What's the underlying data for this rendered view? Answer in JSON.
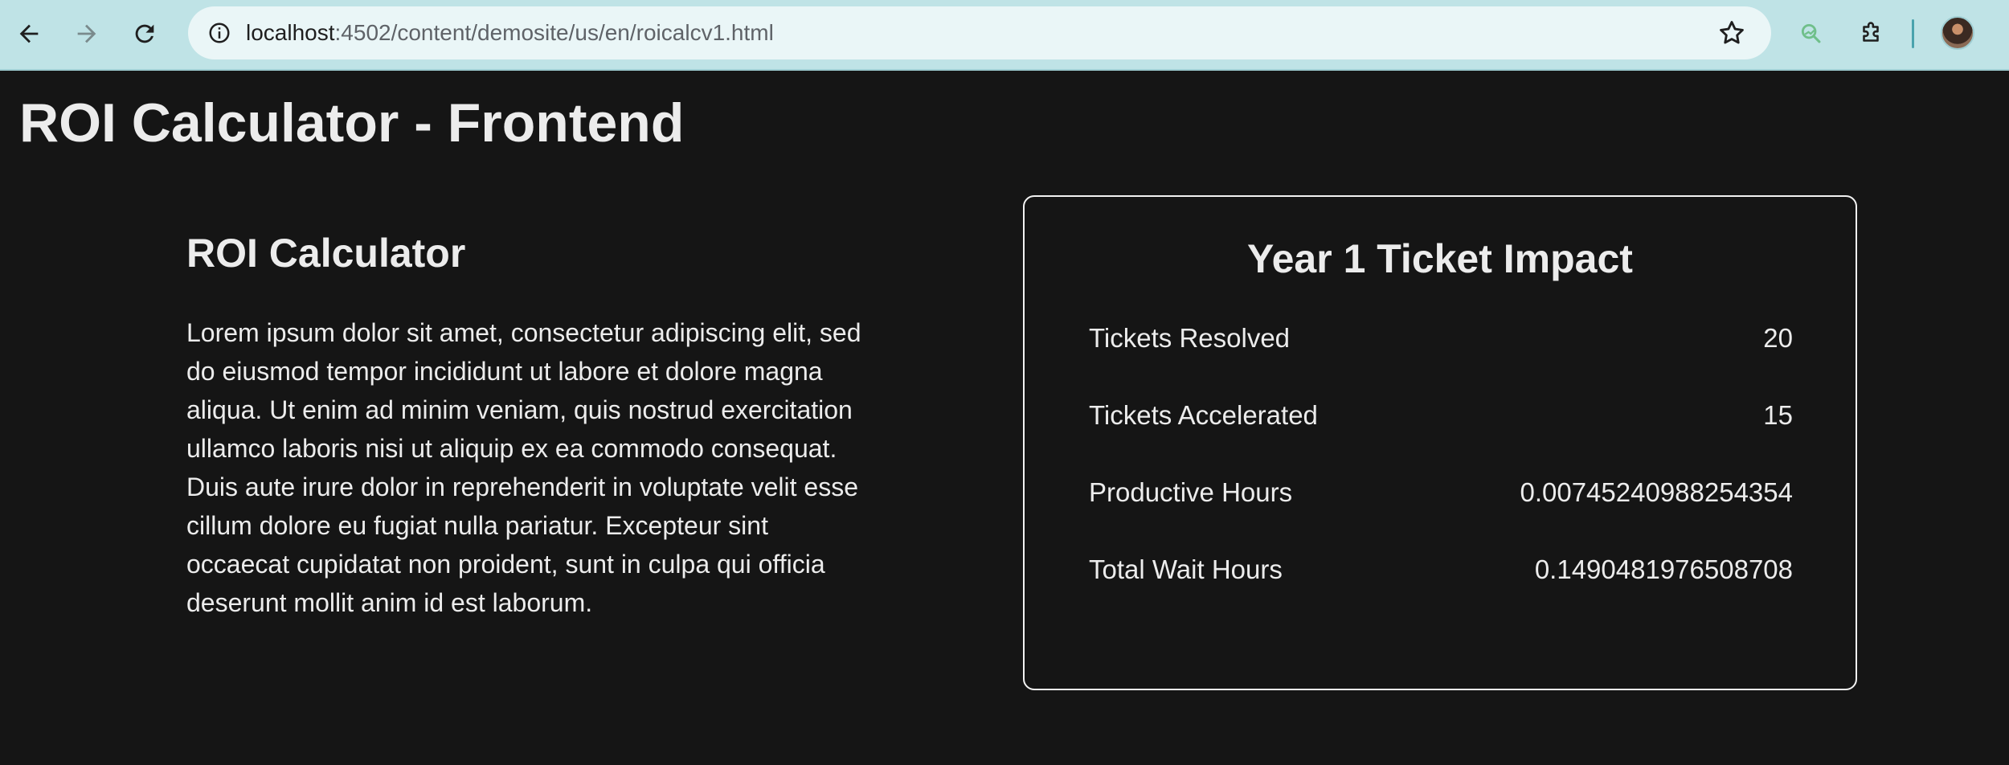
{
  "browser": {
    "url_host": "localhost",
    "url_path": ":4502/content/demosite/us/en/roicalcv1.html",
    "icons": {
      "back": "arrow-left-icon",
      "forward": "arrow-right-icon",
      "reload": "reload-icon",
      "info": "info-icon",
      "bookmark": "star-icon",
      "lens": "search-lens-icon",
      "extensions": "puzzle-icon",
      "profile": "avatar"
    },
    "colors": {
      "toolbar": "#bfe3e6",
      "omnibox": "#eaf6f7"
    }
  },
  "page": {
    "title": "ROI Calculator - Frontend",
    "background": "#151515"
  },
  "calculator": {
    "heading": "ROI Calculator",
    "description": "Lorem ipsum dolor sit amet, consectetur adipiscing elit, sed do eiusmod tempor incididunt ut labore et dolore magna aliqua. Ut enim ad minim veniam, quis nostrud exercitation ullamco laboris nisi ut aliquip ex ea commodo consequat. Duis aute irure dolor in reprehenderit in voluptate velit esse cillum dolore eu fugiat nulla pariatur. Excepteur sint occaecat cupidatat non proident, sunt in culpa qui officia deserunt mollit anim id est laborum."
  },
  "impact": {
    "title": "Year 1 Ticket Impact",
    "metrics": [
      {
        "label": "Tickets Resolved",
        "value": "20"
      },
      {
        "label": "Tickets Accelerated",
        "value": "15"
      },
      {
        "label": "Productive Hours",
        "value": "0.00745240988254354"
      },
      {
        "label": "Total Wait Hours",
        "value": "0.1490481976508708"
      }
    ]
  }
}
